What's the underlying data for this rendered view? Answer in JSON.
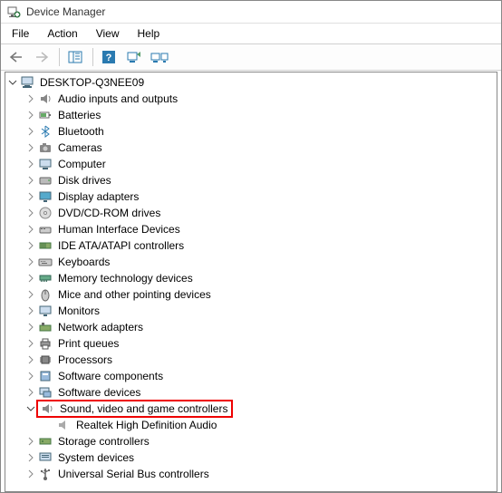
{
  "window": {
    "title": "Device Manager"
  },
  "menubar": {
    "file": "File",
    "action": "Action",
    "view": "View",
    "help": "Help"
  },
  "tree": {
    "root": "DESKTOP-Q3NEE09",
    "items": [
      "Audio inputs and outputs",
      "Batteries",
      "Bluetooth",
      "Cameras",
      "Computer",
      "Disk drives",
      "Display adapters",
      "DVD/CD-ROM drives",
      "Human Interface Devices",
      "IDE ATA/ATAPI controllers",
      "Keyboards",
      "Memory technology devices",
      "Mice and other pointing devices",
      "Monitors",
      "Network adapters",
      "Print queues",
      "Processors",
      "Software components",
      "Software devices",
      "Sound, video and game controllers",
      "Storage controllers",
      "System devices",
      "Universal Serial Bus controllers"
    ],
    "soundChild": "Realtek High Definition Audio",
    "highlightColor": "#e00000"
  }
}
